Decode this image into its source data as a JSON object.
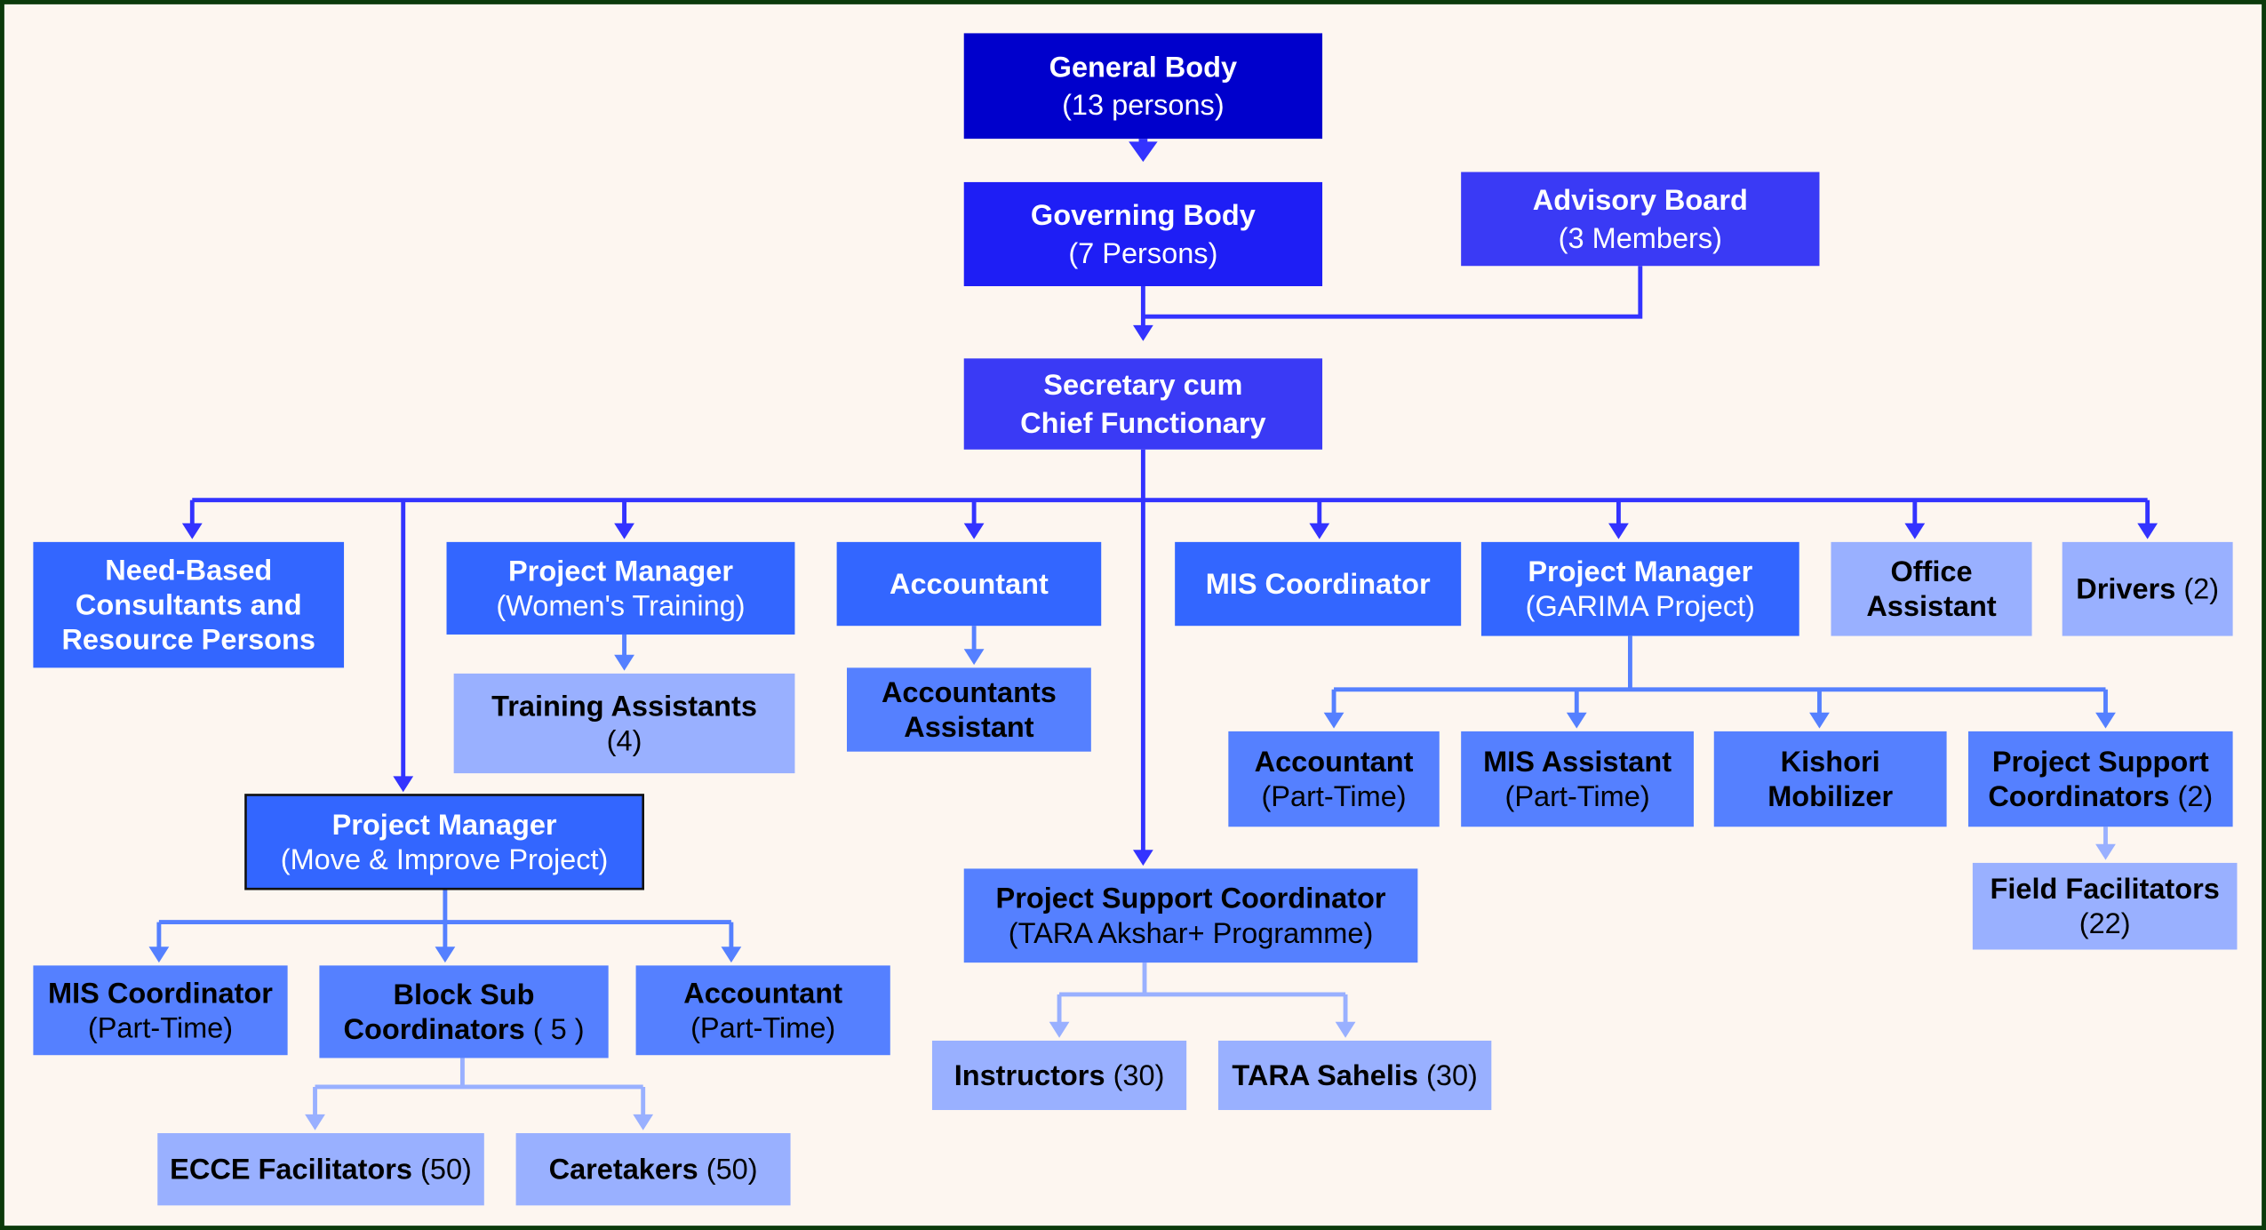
{
  "colors": {
    "background": "#fdf6f0",
    "frame": "#0b3a0b",
    "level_top": "#0000cc",
    "level_governing": "#1e1ef5",
    "level_advisory": "#3a3af5",
    "level_primary": "#3366ff",
    "level_secondary": "#5580ff",
    "level_tertiary": "#99b0ff",
    "connector_dark": "#3333ff",
    "connector_mid": "#5580ff",
    "connector_light": "#99b0ff",
    "text_light": "#ffffff",
    "text_dark": "#000000"
  },
  "nodes": [
    {
      "id": "general-body",
      "lines": [
        {
          "text": "General Body",
          "bold": true
        },
        {
          "text": "(13 persons)",
          "bold": false
        }
      ],
      "tone": "level_top",
      "text": "light"
    },
    {
      "id": "governing-body",
      "lines": [
        {
          "text": "Governing Body",
          "bold": true
        },
        {
          "text": "(7 Persons)",
          "bold": false
        }
      ],
      "tone": "level_governing",
      "text": "light"
    },
    {
      "id": "advisory-board",
      "lines": [
        {
          "text": "Advisory Board",
          "bold": true
        },
        {
          "text": "(3 Members)",
          "bold": false
        }
      ],
      "tone": "level_advisory",
      "text": "light"
    },
    {
      "id": "secretary",
      "lines": [
        {
          "text": "Secretary cum",
          "bold": true
        },
        {
          "text": "Chief Functionary",
          "bold": true
        }
      ],
      "tone": "level_advisory",
      "text": "light"
    },
    {
      "id": "consultants",
      "lines": [
        {
          "text": "Need-Based",
          "bold": true
        },
        {
          "text": "Consultants and",
          "bold": true
        },
        {
          "text": "Resource Persons",
          "bold": true
        }
      ],
      "tone": "level_primary",
      "text": "light"
    },
    {
      "id": "pm-womens-training",
      "lines": [
        {
          "text": "Project Manager",
          "bold": true
        },
        {
          "text": "(Women's Training)",
          "bold": false
        }
      ],
      "tone": "level_primary",
      "text": "light"
    },
    {
      "id": "accountant",
      "lines": [
        {
          "text": "Accountant",
          "bold": true
        }
      ],
      "tone": "level_primary",
      "text": "light"
    },
    {
      "id": "mis-coordinator",
      "lines": [
        {
          "text": "MIS Coordinator",
          "bold": true
        }
      ],
      "tone": "level_primary",
      "text": "light"
    },
    {
      "id": "pm-garima",
      "lines": [
        {
          "text": "Project Manager",
          "bold": true
        },
        {
          "text": "(GARIMA Project)",
          "bold": false
        }
      ],
      "tone": "level_primary",
      "text": "light"
    },
    {
      "id": "office-assistant",
      "lines": [
        {
          "text": "Office",
          "bold": true
        },
        {
          "text": "Assistant",
          "bold": true
        }
      ],
      "tone": "level_tertiary",
      "text": "dark"
    },
    {
      "id": "drivers",
      "lines": [
        {
          "text": "Drivers",
          "bold": true,
          "suffix": " (2)"
        }
      ],
      "tone": "level_tertiary",
      "text": "dark"
    },
    {
      "id": "training-assistants",
      "lines": [
        {
          "text": "Training Assistants",
          "bold": true
        },
        {
          "text": "(4)",
          "bold": false
        }
      ],
      "tone": "level_tertiary",
      "text": "dark"
    },
    {
      "id": "accountants-assistant",
      "lines": [
        {
          "text": "Accountants",
          "bold": true
        },
        {
          "text": "Assistant",
          "bold": true
        }
      ],
      "tone": "level_secondary",
      "text": "dark"
    },
    {
      "id": "garima-accountant",
      "lines": [
        {
          "text": "Accountant",
          "bold": true
        },
        {
          "text": "(Part-Time)",
          "bold": false
        }
      ],
      "tone": "level_secondary",
      "text": "dark"
    },
    {
      "id": "garima-mis-assistant",
      "lines": [
        {
          "text": "MIS Assistant",
          "bold": true
        },
        {
          "text": "(Part-Time)",
          "bold": false
        }
      ],
      "tone": "level_secondary",
      "text": "dark"
    },
    {
      "id": "kishori-mobilizer",
      "lines": [
        {
          "text": "Kishori",
          "bold": true
        },
        {
          "text": "Mobilizer",
          "bold": true
        }
      ],
      "tone": "level_secondary",
      "text": "dark"
    },
    {
      "id": "garima-psc",
      "lines": [
        {
          "text": "Project Support",
          "bold": true
        },
        {
          "text": "Coordinators",
          "bold": true,
          "suffix": " (2)"
        }
      ],
      "tone": "level_secondary",
      "text": "dark"
    },
    {
      "id": "field-facilitators",
      "lines": [
        {
          "text": "Field Facilitators",
          "bold": true
        },
        {
          "text": "(22)",
          "bold": false
        }
      ],
      "tone": "level_tertiary",
      "text": "dark"
    },
    {
      "id": "pm-move-improve",
      "lines": [
        {
          "text": "Project Manager",
          "bold": true
        },
        {
          "text": "(Move & Improve Project)",
          "bold": false
        }
      ],
      "tone": "level_primary",
      "text": "light",
      "selected": true
    },
    {
      "id": "mi-mis-coordinator",
      "lines": [
        {
          "text": "MIS Coordinator",
          "bold": true
        },
        {
          "text": "(Part-Time)",
          "bold": false
        }
      ],
      "tone": "level_secondary",
      "text": "dark"
    },
    {
      "id": "block-sub-coordinators",
      "lines": [
        {
          "text": "Block Sub",
          "bold": true
        },
        {
          "text": "Coordinators",
          "bold": true,
          "suffix": " ( 5 )"
        }
      ],
      "tone": "level_secondary",
      "text": "dark"
    },
    {
      "id": "mi-accountant",
      "lines": [
        {
          "text": "Accountant",
          "bold": true
        },
        {
          "text": "(Part-Time)",
          "bold": false
        }
      ],
      "tone": "level_secondary",
      "text": "dark"
    },
    {
      "id": "ecce-facilitators",
      "lines": [
        {
          "text": "ECCE Facilitators",
          "bold": true,
          "suffix": " (50)"
        }
      ],
      "tone": "level_tertiary",
      "text": "dark"
    },
    {
      "id": "caretakers",
      "lines": [
        {
          "text": "Caretakers",
          "bold": true,
          "suffix": " (50)"
        }
      ],
      "tone": "level_tertiary",
      "text": "dark"
    },
    {
      "id": "psc-tara",
      "lines": [
        {
          "text": "Project Support Coordinator",
          "bold": true
        },
        {
          "text": "(TARA Akshar+ Programme)",
          "bold": false
        }
      ],
      "tone": "level_secondary",
      "text": "dark"
    },
    {
      "id": "instructors",
      "lines": [
        {
          "text": "Instructors",
          "bold": true,
          "suffix": " (30)"
        }
      ],
      "tone": "level_tertiary",
      "text": "dark"
    },
    {
      "id": "tara-sahelis",
      "lines": [
        {
          "text": "TARA Sahelis",
          "bold": true,
          "suffix": " (30)"
        }
      ],
      "tone": "level_tertiary",
      "text": "dark"
    }
  ]
}
